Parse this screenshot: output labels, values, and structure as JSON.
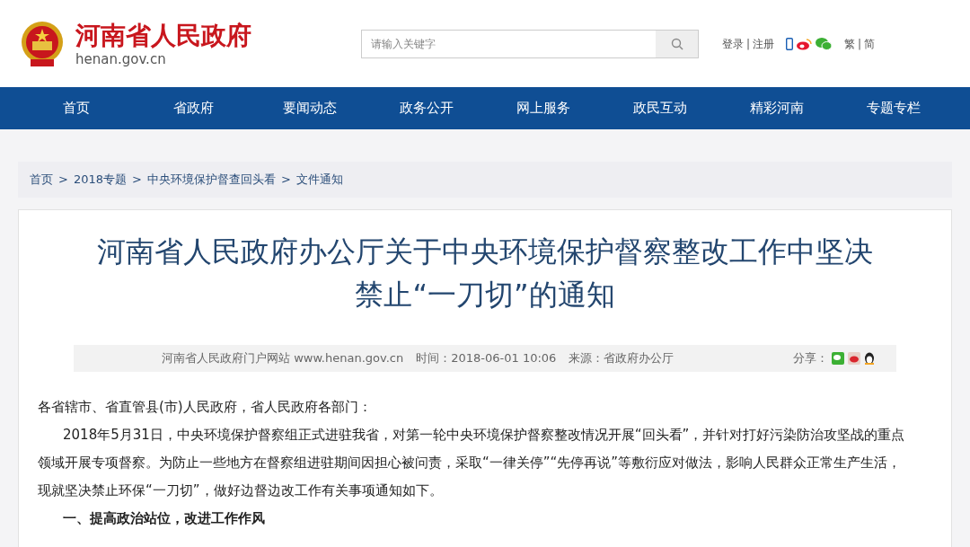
{
  "header": {
    "site_name": "河南省人民政府",
    "domain": "henan.gov.cn",
    "search": {
      "placeholder": "请输入关键字"
    },
    "login": "登录",
    "register": "注册",
    "separator": "|",
    "lang_traditional": "繁",
    "lang_simplified": "简"
  },
  "nav": [
    {
      "label": "首页"
    },
    {
      "label": "省政府"
    },
    {
      "label": "要闻动态"
    },
    {
      "label": "政务公开"
    },
    {
      "label": "网上服务"
    },
    {
      "label": "政民互动"
    },
    {
      "label": "精彩河南"
    },
    {
      "label": "专题专栏"
    }
  ],
  "breadcrumb": [
    {
      "label": "首页"
    },
    {
      "label": "2018专题"
    },
    {
      "label": "中央环境保护督查回头看"
    },
    {
      "label": "文件通知"
    }
  ],
  "breadcrumb_separator": ">",
  "article": {
    "title": "河南省人民政府办公厅关于中央环境保护督察整改工作中坚决禁止“一刀切”的通知",
    "meta": {
      "publisher": "河南省人民政府门户网站 www.henan.gov.cn",
      "time": "时间：2018-06-01 10:06",
      "source": "来源：省政府办公厅",
      "share": "分享："
    },
    "salutation": "各省辖市、省直管县(市)人民政府，省人民政府各部门：",
    "paragraphs": [
      "2018年5月31日，中央环境保护督察组正式进驻我省，对第一轮中央环境保护督察整改情况开展“回头看”，并针对打好污染防治攻坚战的重点领域开展专项督察。为防止一些地方在督察组进驻期间因担心被问责，采取“一律关停”“先停再说”等敷衍应对做法，影响人民群众正常生产生活，现就坚决禁止环保“一刀切”，做好边督边改工作有关事项通知如下。"
    ],
    "section_heading": "一、提高政治站位，改进工作作风"
  }
}
